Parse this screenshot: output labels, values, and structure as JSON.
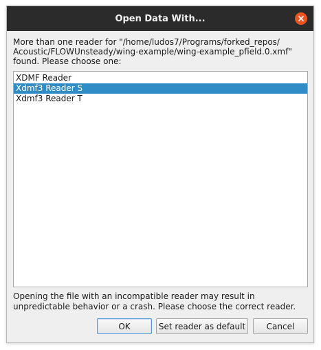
{
  "window": {
    "title": "Open Data With..."
  },
  "message": {
    "line1": "More than one reader for \"/home/ludos7/Programs/forked_repos/",
    "line2": "Acoustic/FLOWUnsteady/wing-example/wing-example_pfield.0.xmf\"",
    "line3": "found. Please choose one:"
  },
  "readers": {
    "items": [
      {
        "label": "XDMF Reader"
      },
      {
        "label": "Xdmf3 Reader S"
      },
      {
        "label": "Xdmf3 Reader T"
      }
    ],
    "selected": "Xdmf3 Reader S"
  },
  "warning": {
    "line1": "Opening the file with an incompatible reader may result in",
    "line2": "unpredictable behavior or a crash.  Please choose the correct reader."
  },
  "buttons": {
    "ok": "OK",
    "set_default": "Set reader as default",
    "cancel": "Cancel"
  },
  "colors": {
    "titlebar": "#2b2b2b",
    "close_button": "#e95420",
    "selection": "#308cc6"
  },
  "icons": {
    "close": "close-icon"
  }
}
